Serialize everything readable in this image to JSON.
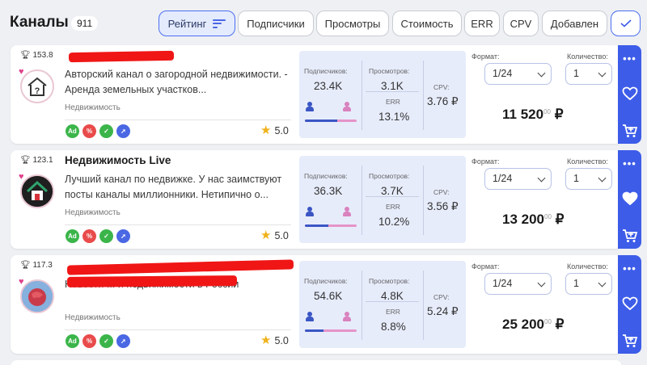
{
  "header": {
    "title": "Каналы",
    "count": "911",
    "sort_buttons": [
      {
        "label": "Рейтинг",
        "active": true
      },
      {
        "label": "Подписчики"
      },
      {
        "label": "Просмотры"
      },
      {
        "label": "Стоимость"
      },
      {
        "label": "ERR"
      },
      {
        "label": "CPV"
      },
      {
        "label": "Добавлен"
      }
    ],
    "check_icon": "check-icon"
  },
  "labels": {
    "subscribers": "Подписчиков:",
    "views": "Просмотров:",
    "err": "ERR",
    "cpv": "CPV:",
    "format": "Формат:",
    "quantity": "Количество:"
  },
  "colors": {
    "accent": "#3d5ce8",
    "stats_bg": "#e7ecfb",
    "male": "#3a56c4",
    "female": "#e594c8",
    "star": "#f0b21b",
    "redaction": "#f01616"
  },
  "channels": [
    {
      "rating": "153.8",
      "name": "",
      "description": "Авторский канал о загородной недвижимости. - Аренда земельных участков...",
      "category": "Недвижимость",
      "score": "5.0",
      "subscribers": "23.4K",
      "views": "3.1K",
      "err": "13.1%",
      "cpv": "3.76 ₽",
      "male_share": 0.62,
      "format": "1/24",
      "quantity": "1",
      "price_main": "11 520",
      "price_cents": "00",
      "currency": "₽",
      "favorited": false
    },
    {
      "rating": "123.1",
      "name": "Недвижимость Live",
      "description": "Лучший канал по недвижке. У нас заимствуют посты каналы миллионники. Нетипично о...",
      "category": "Недвижимость",
      "score": "5.0",
      "subscribers": "36.3K",
      "views": "3.7K",
      "err": "10.2%",
      "cpv": "3.56 ₽",
      "male_share": 0.45,
      "format": "1/24",
      "quantity": "1",
      "price_main": "13 200",
      "price_cents": "00",
      "currency": "₽",
      "favorited": true
    },
    {
      "rating": "117.3",
      "name": "",
      "description": "Новости ... и недвижимости в России",
      "category": "Недвижимость",
      "score": "5.0",
      "subscribers": "54.6K",
      "views": "4.8K",
      "err": "8.8%",
      "cpv": "5.24 ₽",
      "male_share": 0.36,
      "format": "1/24",
      "quantity": "1",
      "price_main": "25 200",
      "price_cents": "00",
      "currency": "₽",
      "favorited": false
    }
  ]
}
